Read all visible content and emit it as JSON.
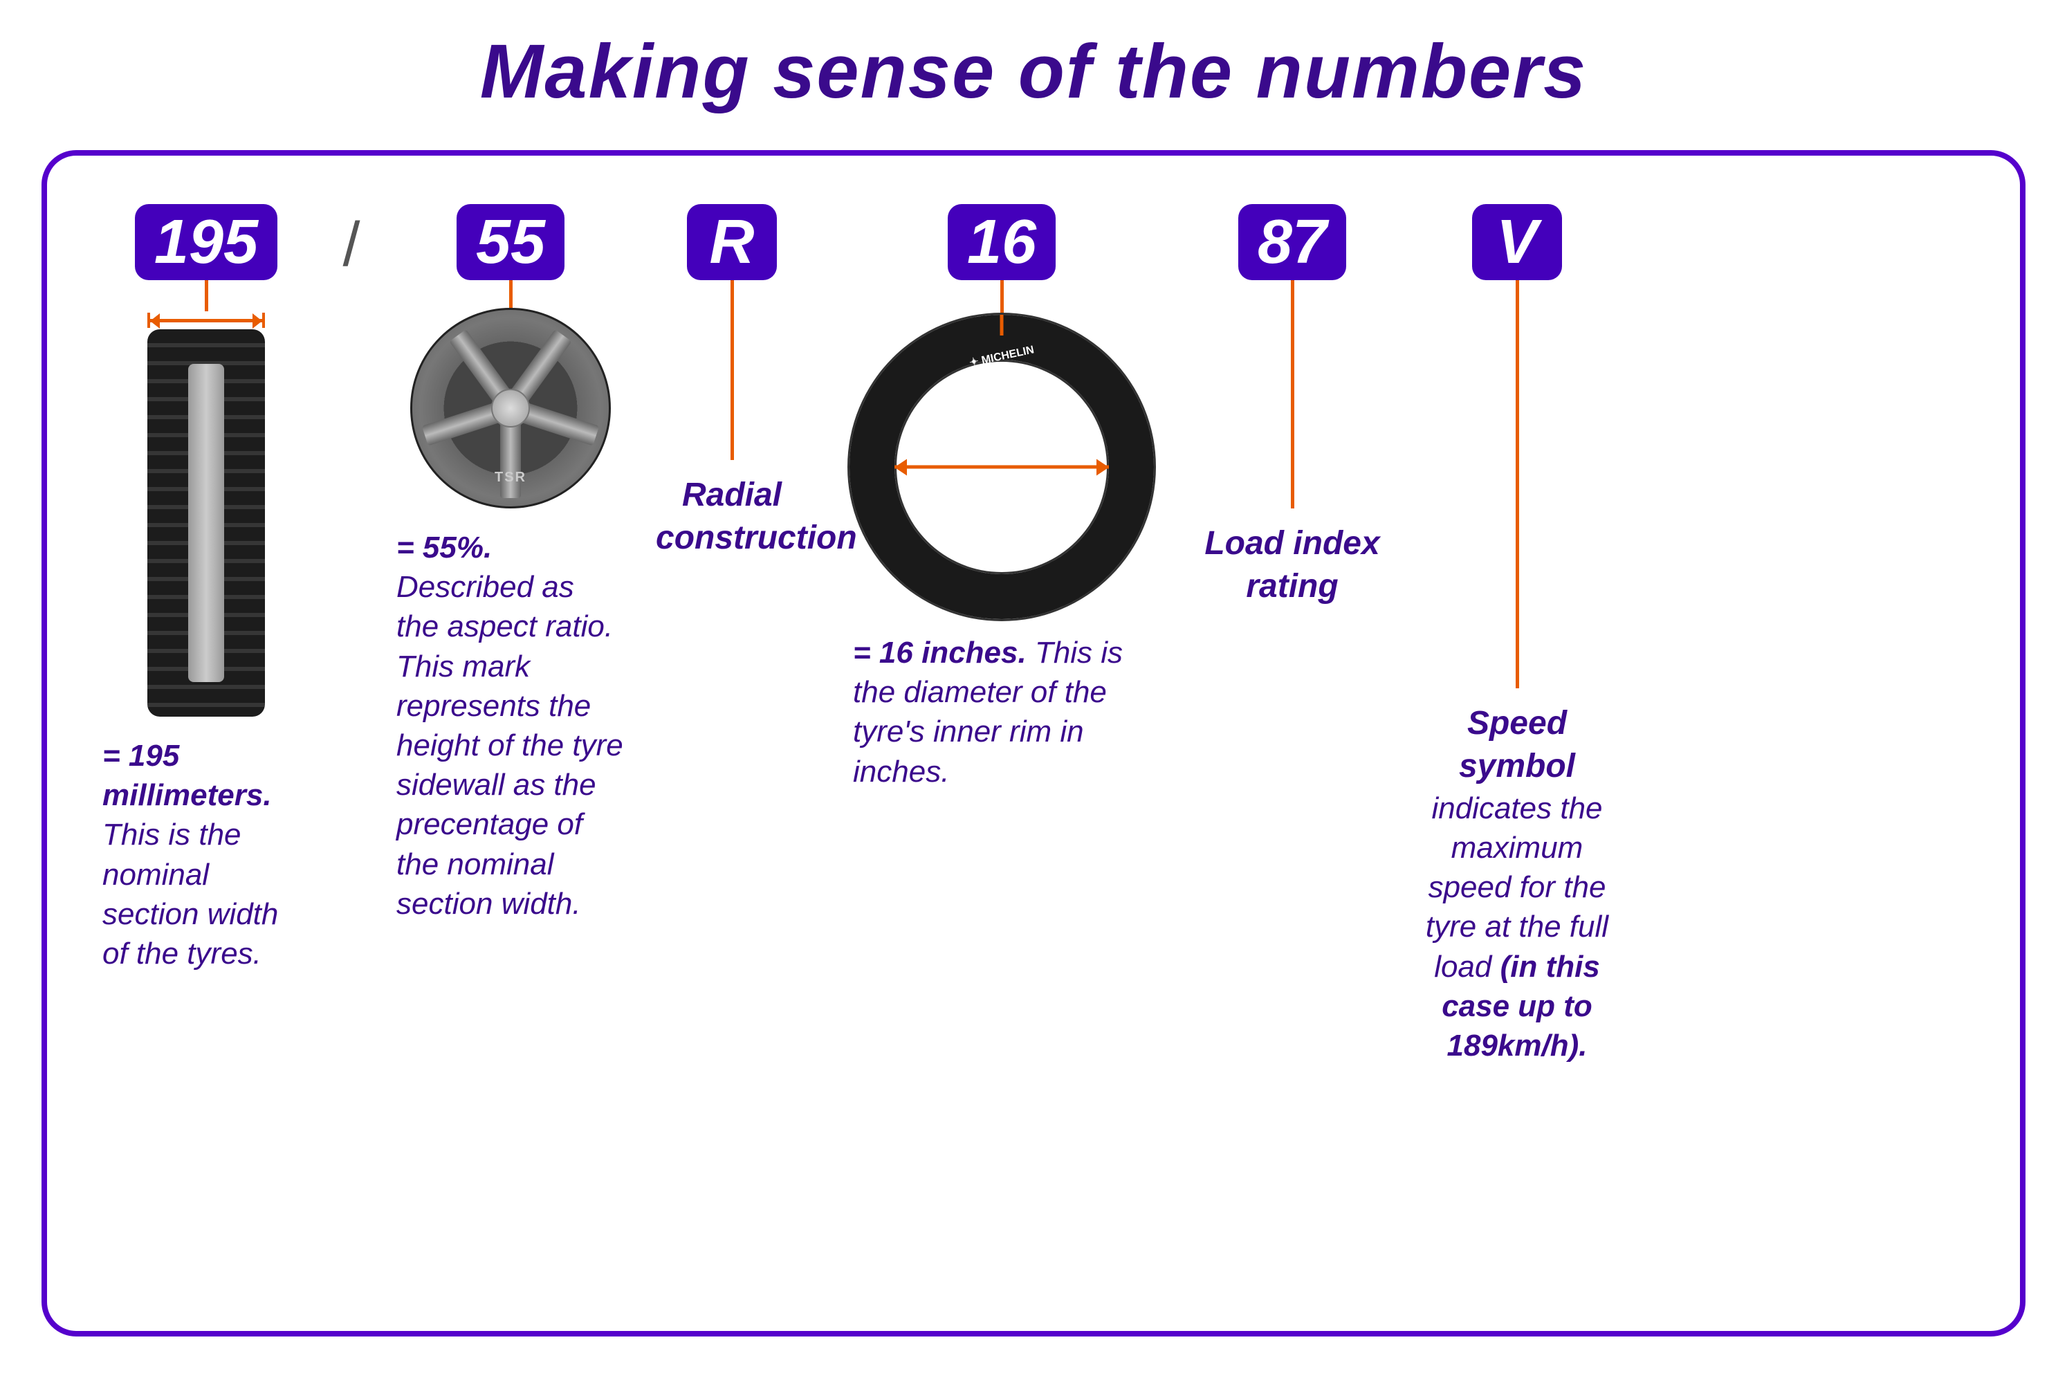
{
  "page": {
    "title": "Making sense of the numbers",
    "background": "#ffffff",
    "border_color": "#5500cc"
  },
  "segments": [
    {
      "id": "195",
      "badge": "195",
      "slash": "/",
      "description_bold": "= 195 millimeters.",
      "description": "This is the nominal section width of the tyres."
    },
    {
      "id": "55",
      "badge": "55",
      "description_bold": "= 55%.",
      "description": "Described as the aspect ratio. This mark represents the height of the tyre sidewall as the precentage of the nominal section width."
    },
    {
      "id": "R",
      "badge": "R",
      "description": "Radial construction"
    },
    {
      "id": "16",
      "badge": "16",
      "description_bold": "= 16 inches.",
      "description": "This is the diameter of the tyre's inner rim in inches."
    },
    {
      "id": "87",
      "badge": "87",
      "description": "Load index rating"
    },
    {
      "id": "V",
      "badge": "V",
      "description_bold": "Speed symbol",
      "description": "indicates the maximum speed for the tyre at the full load",
      "description_italic_bold": "(in this case up to 189km/h)."
    }
  ],
  "colors": {
    "badge_bg": "#4400bb",
    "badge_text": "#ffffff",
    "arrow": "#e85c00",
    "text_purple": "#3a0a8c",
    "border": "#5500cc"
  }
}
